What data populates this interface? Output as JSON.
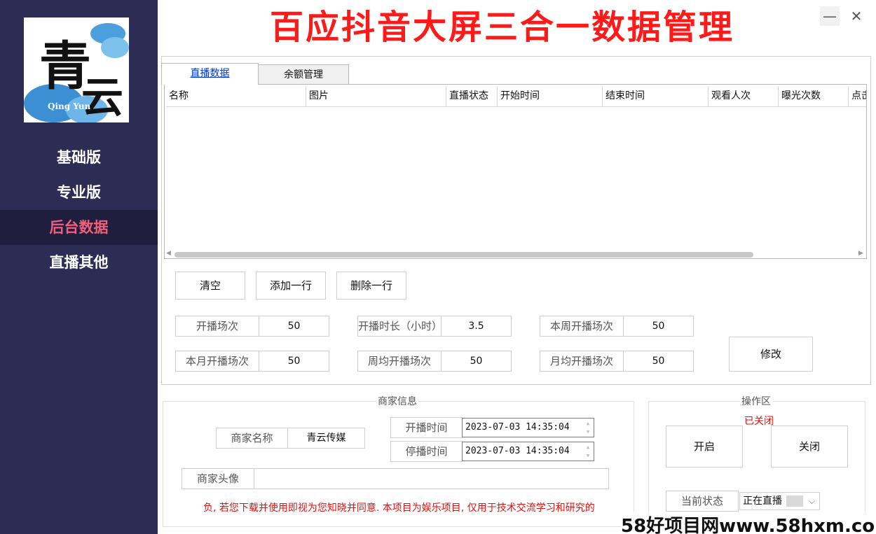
{
  "sidebar": {
    "logo": {
      "char1": "青",
      "char2": "云",
      "sub": "Qing Yun"
    },
    "items": [
      {
        "label": "基础版",
        "active": false
      },
      {
        "label": "专业版",
        "active": false
      },
      {
        "label": "后台数据",
        "active": true
      },
      {
        "label": "直播其他",
        "active": false
      }
    ]
  },
  "header": {
    "title": "百应抖音大屏三合一数据管理",
    "min_icon": "minimize-icon",
    "close_icon": "close-icon"
  },
  "tabs": [
    {
      "label": "直播数据",
      "active": true
    },
    {
      "label": "余额管理",
      "active": false
    }
  ],
  "grid": {
    "columns": [
      "名称",
      "图片",
      "直播状态",
      "开始时间",
      "结束时间",
      "观看人次",
      "曝光次数",
      "点击"
    ],
    "rows": []
  },
  "actions": {
    "clear": "清空",
    "add_row": "添加一行",
    "delete_row": "删除一行",
    "modify": "修改"
  },
  "stats": {
    "live_count_label": "开播场次",
    "live_count": "50",
    "live_hours_label": "开播时长（小时）",
    "live_hours": "3.5",
    "week_count_label": "本周开播场次",
    "week_count": "50",
    "month_count_label": "本月开播场次",
    "month_count": "50",
    "week_avg_label": "周均开播场次",
    "week_avg": "50",
    "month_avg_label": "月均开播场次",
    "month_avg": "50"
  },
  "merchant": {
    "section_title": "商家信息",
    "name_label": "商家名称",
    "name": "青云传媒",
    "start_label": "开播时间",
    "start_time": "2023-07-03 14:35:04",
    "stop_label": "停播时间",
    "stop_time": "2023-07-03 14:35:04",
    "avatar_label": "商家头像",
    "avatar": "",
    "notice": "负, 若您下载并使用即视为您知晓并同意. 本项目为娱乐项目, 仅用于技术交流学习和研究的"
  },
  "operation": {
    "section_title": "操作区",
    "status_text": "已关闭",
    "open": "开启",
    "close": "关闭",
    "current_label": "当前状态",
    "current_value": "正在直播"
  },
  "watermark": "58好项目网www.58hxm.com",
  "colors": {
    "sidebar": "#2d2c55",
    "active_nav": "#f0607a",
    "title": "#ff1a1a",
    "tab_active": "#0036d6",
    "warning": "#e31010"
  }
}
